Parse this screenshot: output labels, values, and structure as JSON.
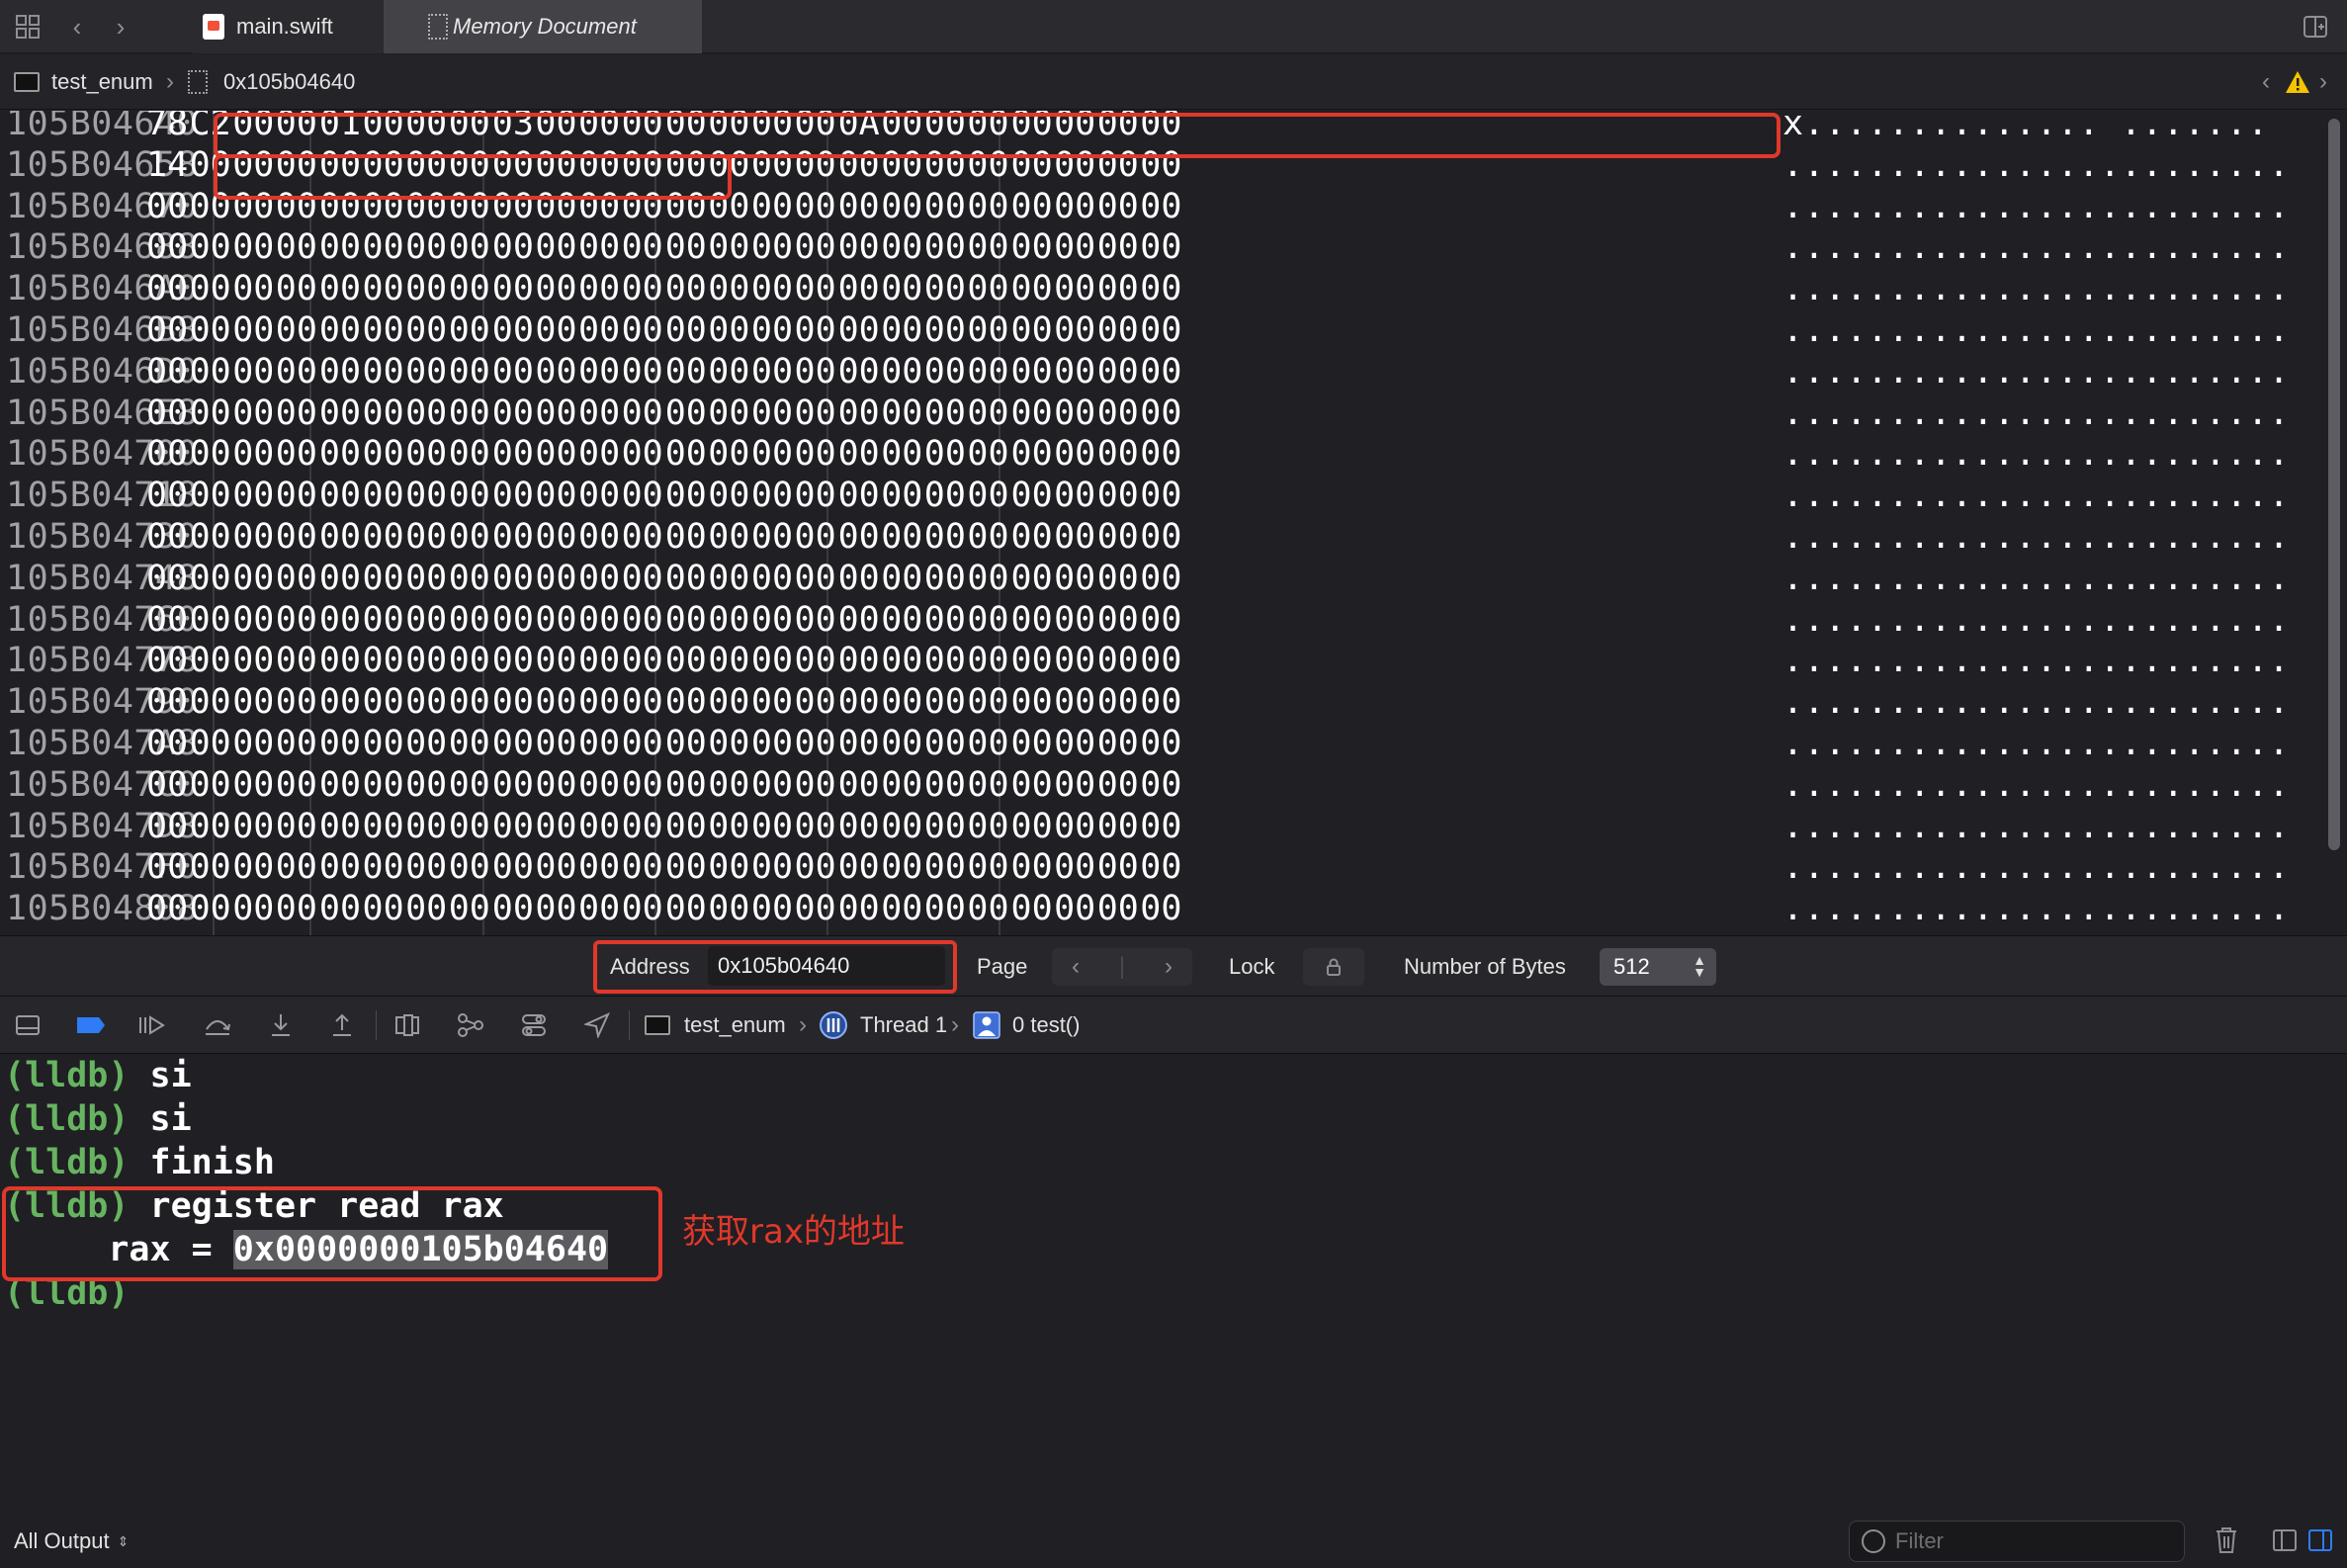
{
  "tabs": [
    {
      "label": "main.swift",
      "active": false
    },
    {
      "label": "Memory Document",
      "active": true
    }
  ],
  "jump_bar": {
    "target": "test_enum",
    "document": "0x105b04640"
  },
  "hex": {
    "rows": [
      {
        "addr": "105B04640",
        "bytes": [
          "78",
          "C2",
          "00",
          "00",
          "01",
          "00",
          "00",
          "00",
          "03",
          "00",
          "00",
          "00",
          "00",
          "00",
          "00",
          "00",
          "0A",
          "00",
          "00",
          "00",
          "00",
          "00",
          "00",
          "00"
        ],
        "ascii": "x.............. ......."
      },
      {
        "addr": "105B04658",
        "bytes": [
          "14",
          "00",
          "00",
          "00",
          "00",
          "00",
          "00",
          "00",
          "00",
          "00",
          "00",
          "00",
          "00",
          "00",
          "00",
          "00",
          "00",
          "00",
          "00",
          "00",
          "00",
          "00",
          "00",
          "00"
        ],
        "ascii": "........................"
      },
      {
        "addr": "105B04670",
        "bytes": [
          "00",
          "00",
          "00",
          "00",
          "00",
          "00",
          "00",
          "00",
          "00",
          "00",
          "00",
          "00",
          "00",
          "00",
          "00",
          "00",
          "00",
          "00",
          "00",
          "00",
          "00",
          "00",
          "00",
          "00"
        ],
        "ascii": "........................"
      },
      {
        "addr": "105B04688",
        "bytes": [
          "00",
          "00",
          "00",
          "00",
          "00",
          "00",
          "00",
          "00",
          "00",
          "00",
          "00",
          "00",
          "00",
          "00",
          "00",
          "00",
          "00",
          "00",
          "00",
          "00",
          "00",
          "00",
          "00",
          "00"
        ],
        "ascii": "........................"
      },
      {
        "addr": "105B046A0",
        "bytes": [
          "00",
          "00",
          "00",
          "00",
          "00",
          "00",
          "00",
          "00",
          "00",
          "00",
          "00",
          "00",
          "00",
          "00",
          "00",
          "00",
          "00",
          "00",
          "00",
          "00",
          "00",
          "00",
          "00",
          "00"
        ],
        "ascii": "........................"
      },
      {
        "addr": "105B046B8",
        "bytes": [
          "00",
          "00",
          "00",
          "00",
          "00",
          "00",
          "00",
          "00",
          "00",
          "00",
          "00",
          "00",
          "00",
          "00",
          "00",
          "00",
          "00",
          "00",
          "00",
          "00",
          "00",
          "00",
          "00",
          "00"
        ],
        "ascii": "........................"
      },
      {
        "addr": "105B046D0",
        "bytes": [
          "00",
          "00",
          "00",
          "00",
          "00",
          "00",
          "00",
          "00",
          "00",
          "00",
          "00",
          "00",
          "00",
          "00",
          "00",
          "00",
          "00",
          "00",
          "00",
          "00",
          "00",
          "00",
          "00",
          "00"
        ],
        "ascii": "........................"
      },
      {
        "addr": "105B046E8",
        "bytes": [
          "00",
          "00",
          "00",
          "00",
          "00",
          "00",
          "00",
          "00",
          "00",
          "00",
          "00",
          "00",
          "00",
          "00",
          "00",
          "00",
          "00",
          "00",
          "00",
          "00",
          "00",
          "00",
          "00",
          "00"
        ],
        "ascii": "........................"
      },
      {
        "addr": "105B04700",
        "bytes": [
          "00",
          "00",
          "00",
          "00",
          "00",
          "00",
          "00",
          "00",
          "00",
          "00",
          "00",
          "00",
          "00",
          "00",
          "00",
          "00",
          "00",
          "00",
          "00",
          "00",
          "00",
          "00",
          "00",
          "00"
        ],
        "ascii": "........................"
      },
      {
        "addr": "105B04718",
        "bytes": [
          "00",
          "00",
          "00",
          "00",
          "00",
          "00",
          "00",
          "00",
          "00",
          "00",
          "00",
          "00",
          "00",
          "00",
          "00",
          "00",
          "00",
          "00",
          "00",
          "00",
          "00",
          "00",
          "00",
          "00"
        ],
        "ascii": "........................"
      },
      {
        "addr": "105B04730",
        "bytes": [
          "00",
          "00",
          "00",
          "00",
          "00",
          "00",
          "00",
          "00",
          "00",
          "00",
          "00",
          "00",
          "00",
          "00",
          "00",
          "00",
          "00",
          "00",
          "00",
          "00",
          "00",
          "00",
          "00",
          "00"
        ],
        "ascii": "........................"
      },
      {
        "addr": "105B04748",
        "bytes": [
          "00",
          "00",
          "00",
          "00",
          "00",
          "00",
          "00",
          "00",
          "00",
          "00",
          "00",
          "00",
          "00",
          "00",
          "00",
          "00",
          "00",
          "00",
          "00",
          "00",
          "00",
          "00",
          "00",
          "00"
        ],
        "ascii": "........................"
      },
      {
        "addr": "105B04760",
        "bytes": [
          "00",
          "00",
          "00",
          "00",
          "00",
          "00",
          "00",
          "00",
          "00",
          "00",
          "00",
          "00",
          "00",
          "00",
          "00",
          "00",
          "00",
          "00",
          "00",
          "00",
          "00",
          "00",
          "00",
          "00"
        ],
        "ascii": "........................"
      },
      {
        "addr": "105B04778",
        "bytes": [
          "00",
          "00",
          "00",
          "00",
          "00",
          "00",
          "00",
          "00",
          "00",
          "00",
          "00",
          "00",
          "00",
          "00",
          "00",
          "00",
          "00",
          "00",
          "00",
          "00",
          "00",
          "00",
          "00",
          "00"
        ],
        "ascii": "........................"
      },
      {
        "addr": "105B04790",
        "bytes": [
          "00",
          "00",
          "00",
          "00",
          "00",
          "00",
          "00",
          "00",
          "00",
          "00",
          "00",
          "00",
          "00",
          "00",
          "00",
          "00",
          "00",
          "00",
          "00",
          "00",
          "00",
          "00",
          "00",
          "00"
        ],
        "ascii": "........................"
      },
      {
        "addr": "105B047A8",
        "bytes": [
          "00",
          "00",
          "00",
          "00",
          "00",
          "00",
          "00",
          "00",
          "00",
          "00",
          "00",
          "00",
          "00",
          "00",
          "00",
          "00",
          "00",
          "00",
          "00",
          "00",
          "00",
          "00",
          "00",
          "00"
        ],
        "ascii": "........................"
      },
      {
        "addr": "105B047C0",
        "bytes": [
          "00",
          "00",
          "00",
          "00",
          "00",
          "00",
          "00",
          "00",
          "00",
          "00",
          "00",
          "00",
          "00",
          "00",
          "00",
          "00",
          "00",
          "00",
          "00",
          "00",
          "00",
          "00",
          "00",
          "00"
        ],
        "ascii": "........................"
      },
      {
        "addr": "105B047D8",
        "bytes": [
          "00",
          "00",
          "00",
          "00",
          "00",
          "00",
          "00",
          "00",
          "00",
          "00",
          "00",
          "00",
          "00",
          "00",
          "00",
          "00",
          "00",
          "00",
          "00",
          "00",
          "00",
          "00",
          "00",
          "00"
        ],
        "ascii": "........................"
      },
      {
        "addr": "105B047F0",
        "bytes": [
          "00",
          "00",
          "00",
          "00",
          "00",
          "00",
          "00",
          "00",
          "00",
          "00",
          "00",
          "00",
          "00",
          "00",
          "00",
          "00",
          "00",
          "00",
          "00",
          "00",
          "00",
          "00",
          "00",
          "00"
        ],
        "ascii": "........................"
      },
      {
        "addr": "105B04808",
        "bytes": [
          "00",
          "00",
          "00",
          "00",
          "00",
          "00",
          "00",
          "00",
          "00",
          "00",
          "00",
          "00",
          "00",
          "00",
          "00",
          "00",
          "00",
          "00",
          "00",
          "00",
          "00",
          "00",
          "00",
          "00"
        ],
        "ascii": "........................"
      }
    ]
  },
  "memory_bar": {
    "address_label": "Address",
    "address_value": "0x105b04640",
    "page_label": "Page",
    "lock_label": "Lock",
    "bytes_label": "Number of Bytes",
    "bytes_value": "512"
  },
  "debug_bar": {
    "target": "test_enum",
    "thread": "Thread 1",
    "frame": "0 test()"
  },
  "console": {
    "prompt": "(lldb)",
    "lines": [
      {
        "prompt": "(lldb)",
        "text": " si"
      },
      {
        "prompt": "(lldb)",
        "text": " si"
      },
      {
        "prompt": "(lldb)",
        "text": " finish"
      },
      {
        "prompt": "(lldb)",
        "text": " register read rax"
      }
    ],
    "rax_label": "     rax = ",
    "rax_value": "0x0000000105b04640",
    "annotation": "获取rax的地址"
  },
  "bottom_bar": {
    "output_selector": "All Output",
    "filter_placeholder": "Filter"
  },
  "colors": {
    "highlight_red": "#e0382a",
    "prompt_green": "#67b460",
    "background": "#1f1f24"
  }
}
